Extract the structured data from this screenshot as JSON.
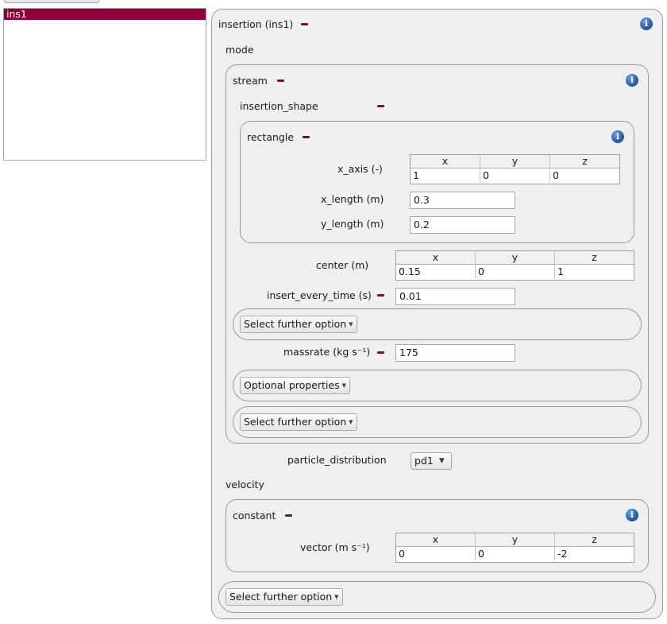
{
  "sidebar": {
    "items": [
      {
        "label": "ins1",
        "selected": true
      }
    ]
  },
  "colors": {
    "selection": "#8e0038",
    "remove_icon": "#8b0836",
    "info_icon": "#2a62ad",
    "panel_bg": "#efefef"
  },
  "insertion": {
    "title": "insertion (ins1)",
    "mode_label": "mode",
    "stream": {
      "title": "stream",
      "insertion_shape_label": "insertion_shape",
      "rectangle": {
        "title": "rectangle",
        "x_axis": {
          "label": "x_axis (-)",
          "headers": [
            "x",
            "y",
            "z"
          ],
          "values": [
            "1",
            "0",
            "0"
          ]
        },
        "x_length": {
          "label": "x_length (m)",
          "value": "0.3"
        },
        "y_length": {
          "label": "y_length (m)",
          "value": "0.2"
        }
      },
      "center": {
        "label": "center (m)",
        "headers": [
          "x",
          "y",
          "z"
        ],
        "values": [
          "0.15",
          "0",
          "1"
        ]
      },
      "insert_every_time": {
        "label": "insert_every_time (s)",
        "value": "0.01"
      },
      "select_further_1": "Select further option",
      "massrate": {
        "label": "massrate (kg s⁻¹)",
        "value": "175"
      },
      "optional_properties": "Optional properties",
      "select_further_2": "Select further option"
    },
    "particle_distribution": {
      "label": "particle_distribution",
      "value": "pd1"
    },
    "velocity_label": "velocity",
    "constant": {
      "title": "constant",
      "vector": {
        "label": "vector (m s⁻¹)",
        "headers": [
          "x",
          "y",
          "z"
        ],
        "values": [
          "0",
          "0",
          "-2"
        ]
      }
    },
    "select_further_outer": "Select further option"
  }
}
